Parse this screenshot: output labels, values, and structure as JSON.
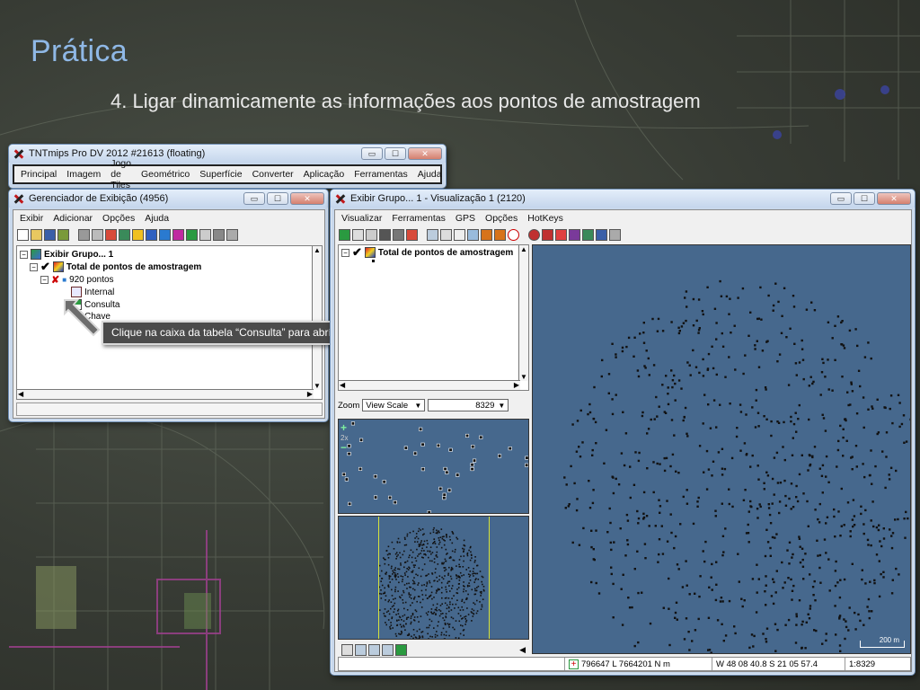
{
  "slide": {
    "title": "Prática",
    "subtitle": "4. Ligar dinamicamente as informações aos pontos de amostragem"
  },
  "main_window": {
    "title": "TNTmips Pro DV 2012  #21613 (floating)",
    "menu": [
      "Principal",
      "Imagem",
      "Jogo de Tiles",
      "Geométrico",
      "Superfície",
      "Converter",
      "Aplicação",
      "Ferramentas",
      "Ajuda"
    ]
  },
  "display_manager": {
    "title": "Gerenciador de Exibição (4956)",
    "menu": [
      "Exibir",
      "Adicionar",
      "Opções",
      "Ajuda"
    ],
    "tree": {
      "group": "Exibir Grupo... 1",
      "layer": "Total de pontos de amostragem",
      "points": "920 pontos",
      "tables": [
        "Internal",
        "Consulta",
        "Chave"
      ]
    }
  },
  "callout": {
    "text": "Clique na caixa da tabela “Consulta” para abrí-la"
  },
  "view_window": {
    "title": "Exibir Grupo... 1 - Visualização 1 (2120)",
    "menu": [
      "Visualizar",
      "Ferramentas",
      "GPS",
      "Opções",
      "HotKeys"
    ],
    "legend_layer": "Total de pontos de amostragem",
    "zoom_label": "Zoom",
    "zoom_mode": "View Scale",
    "zoom_value": "8329",
    "zoom_level": "2x",
    "scale_bar": "200 m",
    "status": {
      "coords": "796647 L  7664201 N m",
      "latlon": "W 48 08 40.8  S 21 05 57.4",
      "scale": "1:8329"
    }
  },
  "colors": {
    "title_blue": "#8fb8e6",
    "map_blue": "#46688d",
    "overview_yellow": "#d6e23a",
    "callout_bg": "#4b4b4b"
  }
}
